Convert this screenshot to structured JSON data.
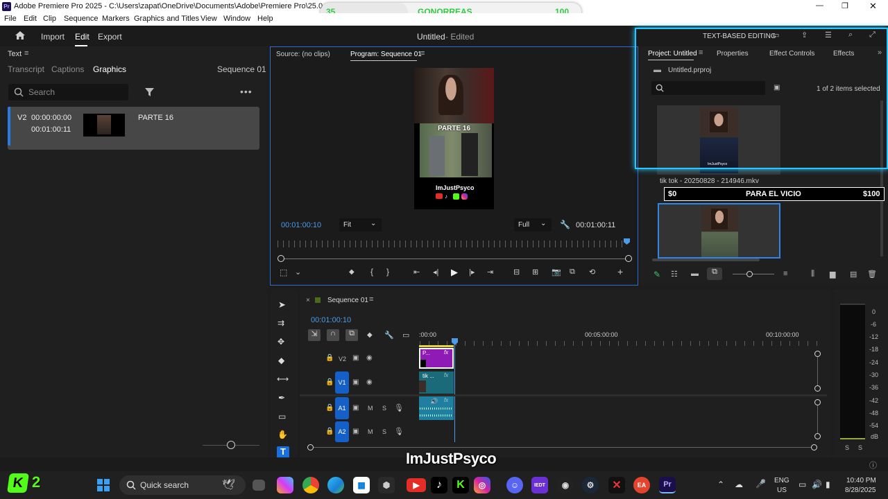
{
  "window": {
    "title": "Adobe Premiere Pro 2025 - C:\\Users\\zapat\\OneDrive\\Documents\\Adobe\\Premiere Pro\\25.0\\Untitled",
    "controls": [
      "—",
      "❐",
      "✕"
    ]
  },
  "overlay_bar": {
    "left": "35",
    "center": "GONORREAS",
    "right": "100"
  },
  "menu": [
    "File",
    "Edit",
    "Clip",
    "Sequence",
    "Markers",
    "Graphics and Titles",
    "View",
    "Window",
    "Help"
  ],
  "header": {
    "tabs": [
      "Import",
      "Edit",
      "Export"
    ],
    "active_tab": "Edit",
    "doc_title": "Untitled",
    "doc_status": "- Edited",
    "text_based_editing": "TEXT-BASED EDITING"
  },
  "text_panel": {
    "title": "Text",
    "tabs": [
      "Transcript",
      "Captions",
      "Graphics"
    ],
    "active_tab": "Graphics",
    "sequence": "Sequence 01",
    "search_placeholder": "Search",
    "item": {
      "track": "V2",
      "in": "00:00:00:00",
      "out": "00:01:00:11",
      "name": "PARTE 16"
    }
  },
  "monitor": {
    "source_tab": "Source: (no clips)",
    "program_tab": "Program: Sequence 01",
    "timecode_left": "00:01:00:10",
    "fit": "Fit",
    "quality": "Full",
    "timecode_right": "00:01:00:11",
    "video_caption": "PARTE 16",
    "video_handle": "ImJustPsyco"
  },
  "project": {
    "tabs": [
      "Project: Untitled",
      "Properties",
      "Effect Controls",
      "Effects"
    ],
    "file": "Untitled.prproj",
    "selection": "1 of 2 items selected",
    "clip_name": "tik tok - 20250828 - 214946.mkv",
    "thumb_caption": "ImJustPsyco"
  },
  "donation_bar": {
    "left": "$0",
    "center": "PARA EL VICIO",
    "right": "$100"
  },
  "timeline": {
    "sequence_tab": "Sequence 01",
    "timecode": "00:01:00:10",
    "ruler": [
      ":00:00",
      "00:05:00:00",
      "00:10:00:00"
    ],
    "tracks": [
      {
        "name": "V2",
        "label": "V2"
      },
      {
        "name": "V1",
        "label": "V1"
      },
      {
        "name": "A1",
        "label": "A1",
        "m": "M",
        "s": "S"
      },
      {
        "name": "A2",
        "label": "A2",
        "m": "M",
        "s": "S"
      }
    ],
    "clip_v2": "P...",
    "clip_v1": "tik ..."
  },
  "meter": {
    "labels": [
      "0",
      "-6",
      "-12",
      "-18",
      "-24",
      "-30",
      "-36",
      "-42",
      "-48",
      "-54",
      "dB"
    ],
    "bottom": [
      "S",
      "S"
    ]
  },
  "stream_overlay": {
    "handle": "ImJustPsyco",
    "count": "2"
  },
  "taskbar": {
    "search": "Quick search",
    "lang": "ENG",
    "region": "US",
    "time": "10:40 PM",
    "date": "8/28/2025"
  },
  "colors": {
    "accent": "#1560c8",
    "v2_clip": "#8f1ab6",
    "v1_clip": "#1b6a7a",
    "audio_clip": "#2a8fb0",
    "playhead": "#4a9be8",
    "overlay_green": "#2ecc40"
  }
}
